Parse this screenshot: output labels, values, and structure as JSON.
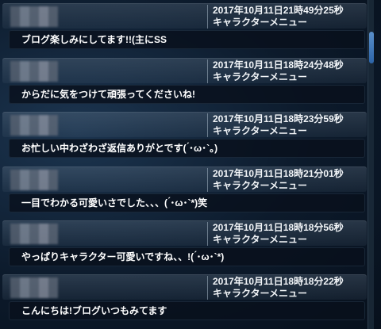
{
  "comments": [
    {
      "timestamp": "2017年10月11日21時49分25秒",
      "category": "キャラクターメニュー",
      "text": "ブログ楽しみにしてます!!(主にSS"
    },
    {
      "timestamp": "2017年10月11日18時24分48秒",
      "category": "キャラクターメニュー",
      "text": "からだに気をつけて頑張ってくださいね!"
    },
    {
      "timestamp": "2017年10月11日18時23分59秒",
      "category": "キャラクターメニュー",
      "text": "お忙しい中わざわざ返信ありがとです( ́･ω･`。)"
    },
    {
      "timestamp": "2017年10月11日18時21分01秒",
      "category": "キャラクターメニュー",
      "text": "一目でわかる可愛いさでした、、、( ́･ω･`*)笑"
    },
    {
      "timestamp": "2017年10月11日18時18分56秒",
      "category": "キャラクターメニュー",
      "text": "やっぱりキャラクター可愛いですね、、!( ́･ω･`*)"
    },
    {
      "timestamp": "2017年10月11日18時18分22秒",
      "category": "キャラクターメニュー",
      "text": "こんにちは!ブログいつもみてます"
    }
  ]
}
